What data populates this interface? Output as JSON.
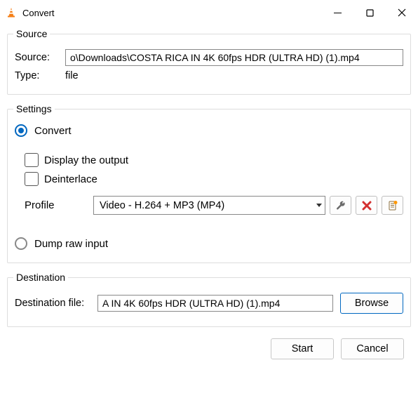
{
  "window": {
    "title": "Convert"
  },
  "source_group": {
    "legend": "Source",
    "source_label": "Source:",
    "source_value": "o\\Downloads\\COSTA RICA IN 4K 60fps HDR (ULTRA HD) (1).mp4",
    "type_label": "Type:",
    "type_value": "file"
  },
  "settings_group": {
    "legend": "Settings",
    "convert_label": "Convert",
    "display_output_label": "Display the output",
    "deinterlace_label": "Deinterlace",
    "profile_label": "Profile",
    "profile_value": "Video - H.264 + MP3 (MP4)",
    "dump_raw_label": "Dump raw input"
  },
  "destination_group": {
    "legend": "Destination",
    "dest_label": "Destination file:",
    "dest_value": "A IN 4K 60fps HDR (ULTRA HD) (1).mp4",
    "browse_label": "Browse"
  },
  "footer": {
    "start_label": "Start",
    "cancel_label": "Cancel"
  }
}
